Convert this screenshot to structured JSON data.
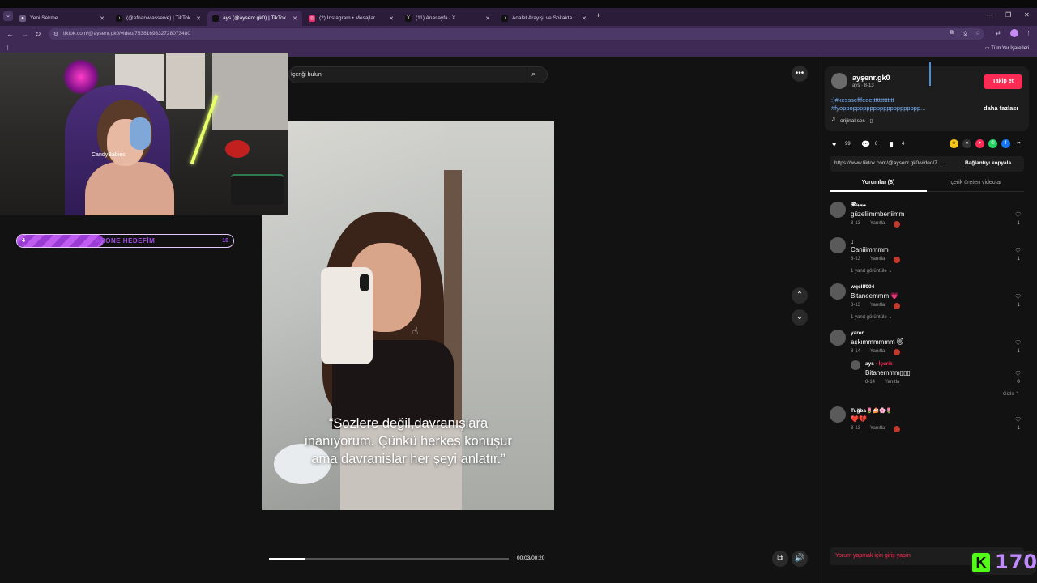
{
  "browser": {
    "tabs": [
      {
        "label": "Yeni Sekme",
        "favicon": "chrome-icon",
        "color": "#6b5a82",
        "active": false
      },
      {
        "label": "(@efnanwiassewe) | TikTok",
        "favicon": "tiktok-icon",
        "color": "#111111",
        "active": false
      },
      {
        "label": "ays (@aysenr.gk0) | TikTok",
        "favicon": "tiktok-icon",
        "color": "#111111",
        "active": true
      },
      {
        "label": "(2) Instagram • Mesajlar",
        "favicon": "instagram-icon",
        "color": "#e1306c",
        "active": false
      },
      {
        "label": "(11) Anasayfa / X",
        "favicon": "x-icon",
        "color": "#111111",
        "active": false
      },
      {
        "label": "Adalet Arayışı ve Sokakta Şiddet",
        "favicon": "tiktok-icon",
        "color": "#111111",
        "active": false
      }
    ],
    "url": "tiktok.com/@aysenr.gk0/video/7538169332728073480",
    "bookmarks_label": "Tüm Yer İşaretleri"
  },
  "stream": {
    "chair_watermark": "CandyBabies",
    "sub_goal": {
      "label": "ABONE HEDEFİM",
      "current": "4",
      "target": "10",
      "progress": 0.4
    },
    "kick_count": "170",
    "kick_logo": "K"
  },
  "tiktok": {
    "search_placeholder": "İçeriği bulun",
    "video": {
      "caption_line1": "“Sozlere değil,davranışlara",
      "caption_line2": "inanıyorum. Çünkü herkes konuşur",
      "caption_line3": "ama davranislar her şeyi anlatır.”",
      "time": "00:03/00:20",
      "progress": 0.15
    },
    "author": {
      "handle": "ayşenr.gk0",
      "sub": "ays · 8-13",
      "follow_label": "Takip et",
      "desc_line1": ":)#kesssefffeeettttttttttttt",
      "desc_line2": "#fyoppopppppppppppppppppppp...",
      "more_label": "daha fazlası",
      "music": "orijinal ses - ▯"
    },
    "actions": {
      "likes": "99",
      "comments": "8",
      "saves": "4"
    },
    "link": {
      "url": "https://www.tiktok.com/@aysenr.gk0/video/7...",
      "copy_label": "Bağlantıyı kopyala"
    },
    "tabs": {
      "comments": "Yorumlar (8)",
      "creator_videos": "İçerik üreten videolar"
    },
    "comments": [
      {
        "user": "𝓑𝓲𝓻𝓪𝓷",
        "text": "güzeliimmbeniimm",
        "date": "8-13",
        "reply": "Yanıtla",
        "likes": "1",
        "views": ""
      },
      {
        "user": "▯",
        "text": "Caniiimmmm",
        "date": "8-13",
        "reply": "Yanıtla",
        "likes": "1",
        "views": "1 yanıt görüntüle ⌄"
      },
      {
        "user": "wqellf004",
        "text": "Bitaneemmm 💗",
        "date": "8-13",
        "reply": "Yanıtla",
        "likes": "1",
        "views": "1 yanıt görüntüle ⌄"
      },
      {
        "user": "yaren",
        "text": "aşkımmmmmm 😻",
        "date": "8-14",
        "reply": "Yanıtla",
        "likes": "1",
        "views": ""
      },
      {
        "user": "Tuğba🌷🍰🌸🌷",
        "text": "❤️💔",
        "date": "8-13",
        "reply": "Yanıtla",
        "likes": "1",
        "views": ""
      }
    ],
    "reply": {
      "user": "ays",
      "creator_tag": "· İçerik",
      "text": "Bitanemmm▯▯▯",
      "date": "8-14",
      "reply": "Yanıtla",
      "likes": "0",
      "hide_label": "Gizle ⌃"
    },
    "comment_placeholder": "Yorum yapmak için giriş yapın"
  },
  "colors": {
    "accent": "#fe2c55",
    "hashtag": "#7fb5ff",
    "browser_bg": "#3e2a55",
    "kick_green": "#53fc18"
  }
}
